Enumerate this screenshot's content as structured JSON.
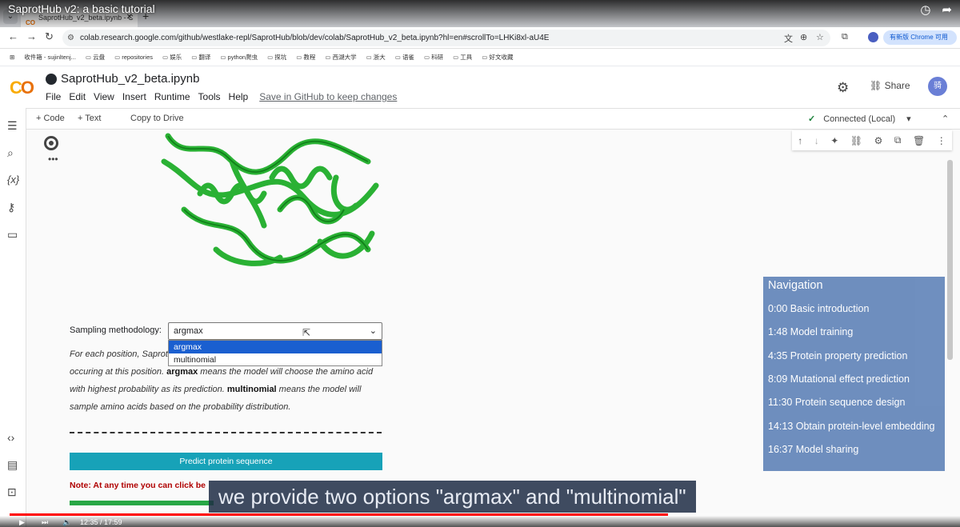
{
  "video": {
    "title": "SaprotHub v2: a basic tutorial",
    "progress_fraction": 0.7,
    "time": "12:35 / 17:59"
  },
  "browser": {
    "tab_title": "SaprotHub_v2_beta.ipynb - C",
    "tab_favicon": "CO",
    "url": "colab.research.google.com/github/westlake-repl/SaprotHub/blob/dev/colab/SaprotHub_v2_beta.ipynb?hl=en#scrollTo=LHKi8xl-aU4E",
    "chrome_button": "有新版 Chrome 可用",
    "bookmarks": [
      "收件箱 - sujinltenj...",
      "云盘",
      "repositories",
      "娱乐",
      "翻译",
      "python爬虫",
      "探坑",
      "教程",
      "西湖大学",
      "浙大",
      "语雀",
      "科研",
      "工具",
      "好文收藏"
    ]
  },
  "colab": {
    "notebook_name": "SaprotHub_v2_beta.ipynb",
    "menu": [
      "File",
      "Edit",
      "View",
      "Insert",
      "Runtime",
      "Tools",
      "Help"
    ],
    "save_link": "Save in GitHub to keep changes",
    "share_label": "Share",
    "avatar_text": "骑",
    "toolbar": {
      "code": "+ Code",
      "text": "+ Text",
      "copy": "Copy to Drive",
      "connected": "Connected (Local)"
    }
  },
  "cell": {
    "sampling_label": "Sampling methodology:",
    "selected_value": "argmax",
    "options": [
      "argmax",
      "multinomial"
    ],
    "desc_line1": "For each position, Saprot",
    "desc_line2a": "occuring at this position. ",
    "desc_line2b": "argmax",
    "desc_line2c": " means the model will choose the amino acid",
    "desc_line3a": "with highest probability as its prediction. ",
    "desc_line3b": "multinomial",
    "desc_line3c": " means the model will",
    "desc_line4": "sample amino acids based on the probability distribution.",
    "predict_button": "Predict protein sequence",
    "note": "Note: At any time you can click be"
  },
  "navigation": {
    "title": "Navigation",
    "items": [
      "0:00 Basic introduction",
      "1:48 Model training",
      "4:35 Protein property prediction",
      "8:09 Mutational effect prediction",
      "11:30 Protein sequence design",
      "14:13 Obtain protein-level embedding",
      "16:37 Model sharing"
    ]
  },
  "subtitle": "we provide two options \"argmax\" and \"multinomial\"",
  "colors": {
    "protein": "#1fae2a",
    "predict_button": "#17a2b8",
    "nav_panel": "#6a8bbd",
    "note": "#b00000"
  }
}
